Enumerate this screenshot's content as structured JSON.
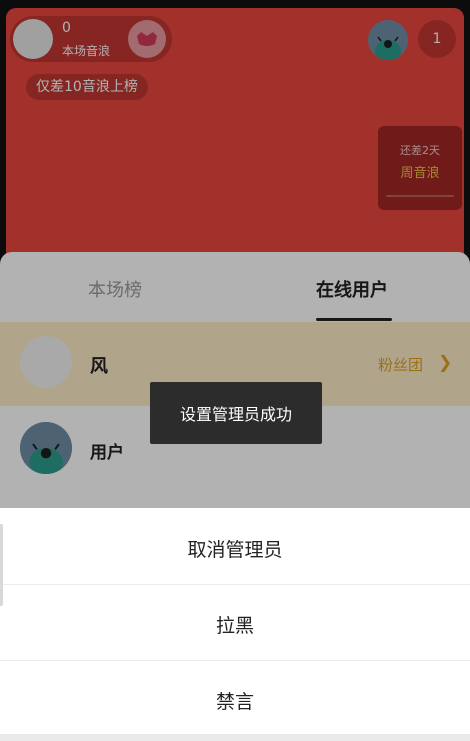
{
  "stream": {
    "host": {
      "count": "0",
      "subtitle": "本场音浪"
    },
    "rank_hint": "仅差10音浪上榜",
    "viewer_count": "1",
    "weekly": {
      "line1": "还差2天",
      "line2": "周音浪"
    }
  },
  "panel": {
    "tabs": [
      {
        "label": "本场榜",
        "active": false
      },
      {
        "label": "在线用户",
        "active": true
      }
    ],
    "rows": [
      {
        "name": "风",
        "tag": "粉丝团"
      },
      {
        "name": "用户"
      }
    ]
  },
  "toast": {
    "text": "设置管理员成功"
  },
  "action_sheet": {
    "items": [
      "取消管理员",
      "拉黑",
      "禁言"
    ]
  },
  "colors": {
    "stream_bg": "#e8473f",
    "fan_row_bg": "#fdecc8",
    "fan_tag": "#d9a21e",
    "gold": "#f0c24b"
  }
}
